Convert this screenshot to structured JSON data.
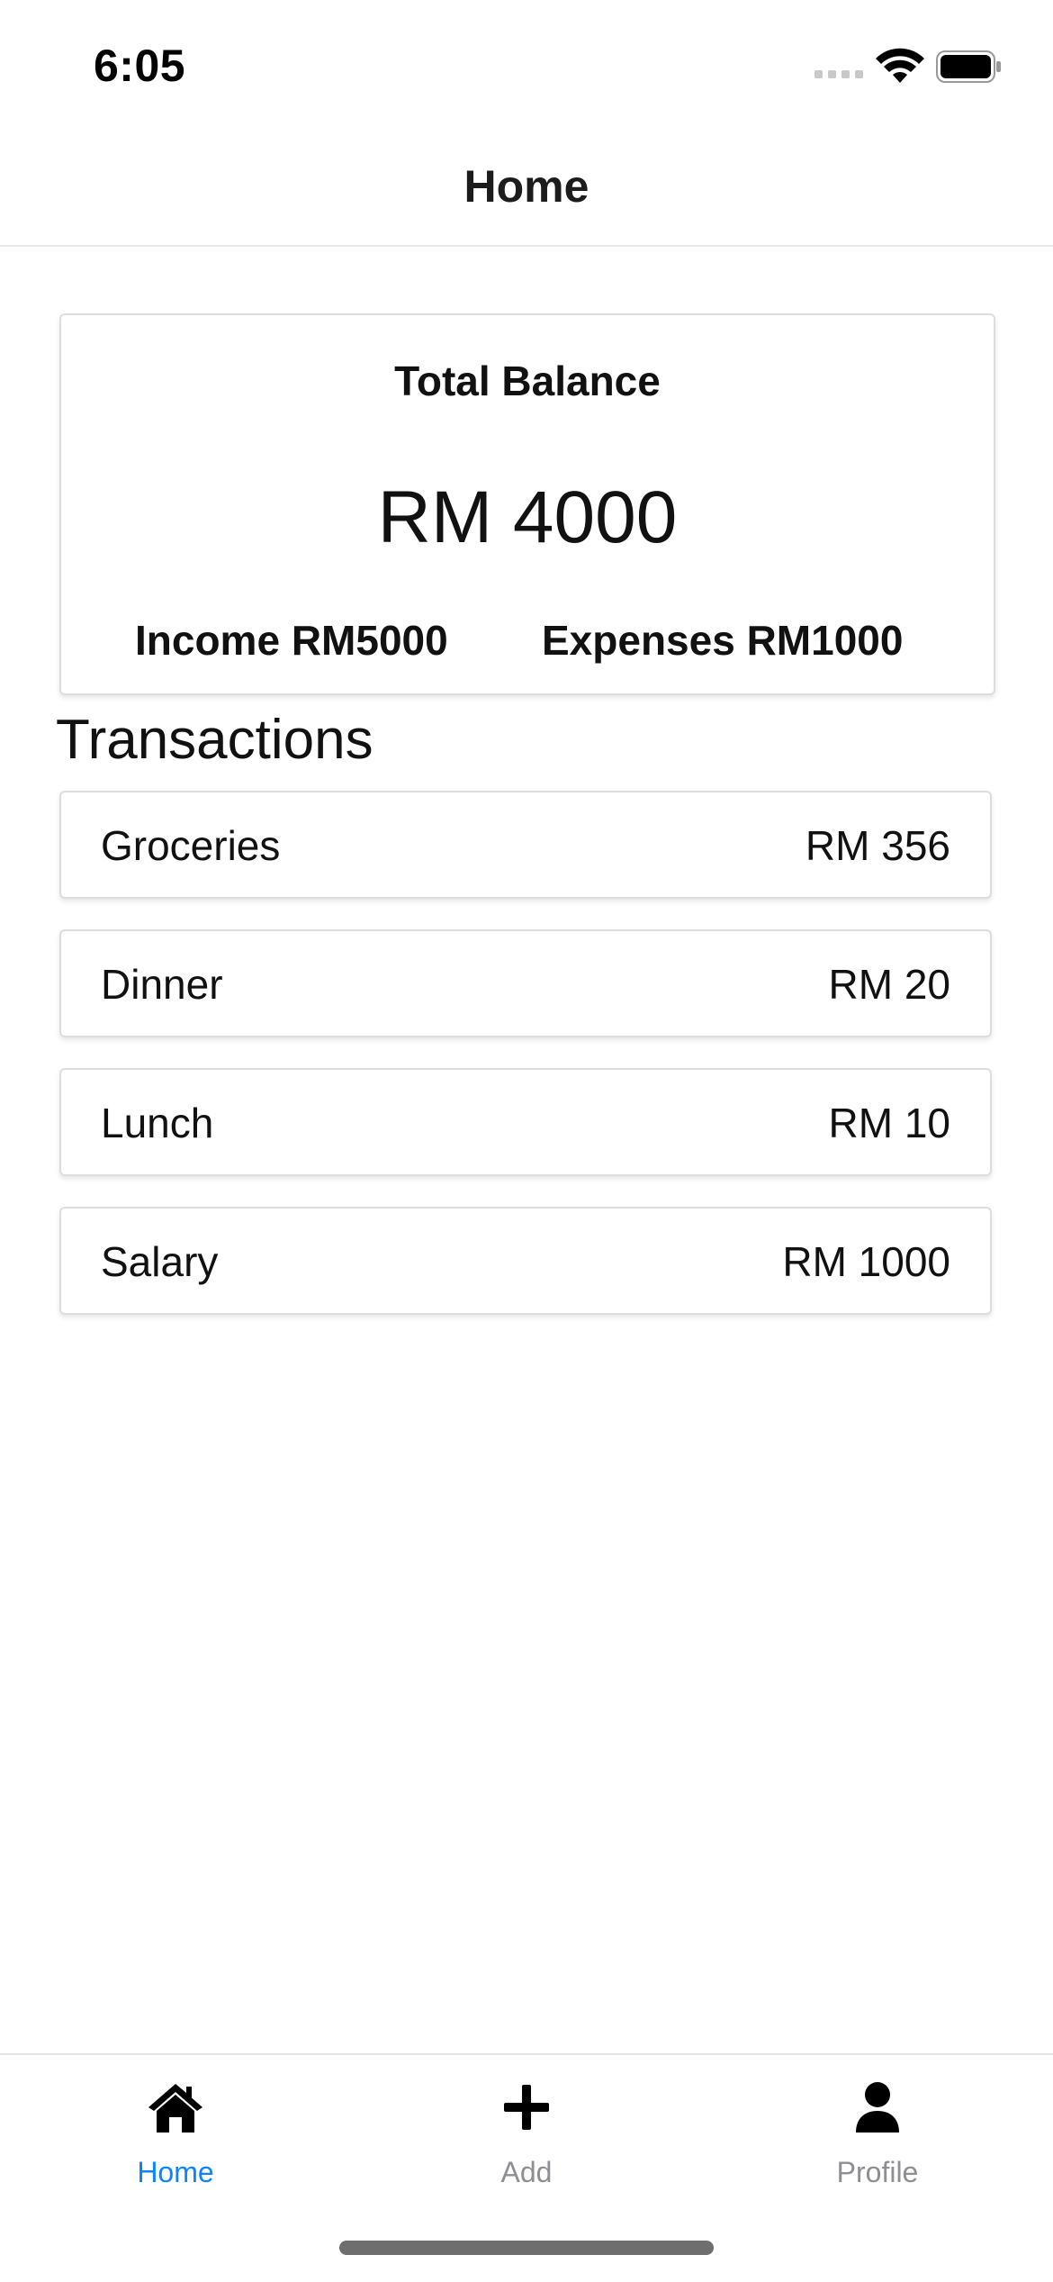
{
  "status_bar": {
    "time": "6:05"
  },
  "header": {
    "title": "Home"
  },
  "balance": {
    "title": "Total Balance",
    "amount": "RM 4000",
    "income": "Income RM5000",
    "expenses": "Expenses RM1000"
  },
  "transactions": {
    "title": "Transactions",
    "items": [
      {
        "name": "Groceries",
        "amount": "RM 356"
      },
      {
        "name": "Dinner",
        "amount": "RM 20"
      },
      {
        "name": "Lunch",
        "amount": "RM 10"
      },
      {
        "name": "Salary",
        "amount": "RM 1000"
      }
    ]
  },
  "tabs": [
    {
      "label": "Home",
      "icon": "home-icon",
      "active": true
    },
    {
      "label": "Add",
      "icon": "plus-icon",
      "active": false
    },
    {
      "label": "Profile",
      "icon": "user-icon",
      "active": false
    }
  ],
  "colors": {
    "accent": "#0a84ff",
    "inactive": "#8e8e93"
  }
}
